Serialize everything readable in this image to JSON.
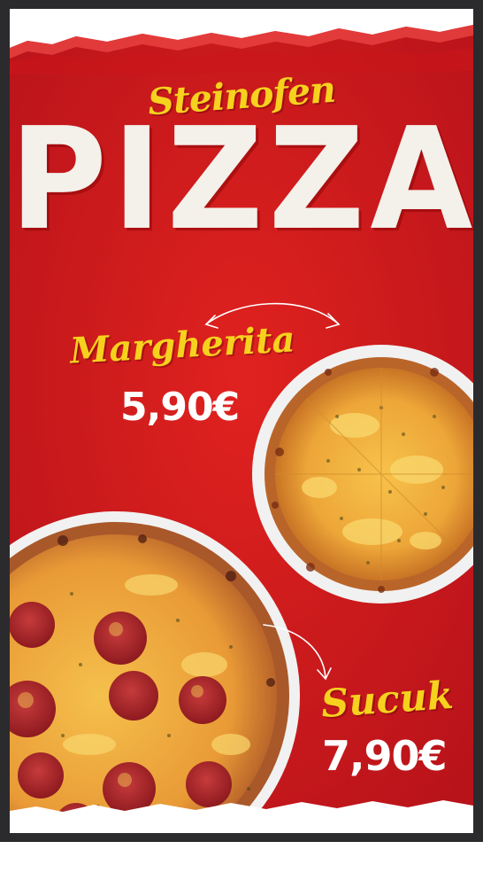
{
  "poster": {
    "subtitle": "Steinofen",
    "title": "PIZZA",
    "items": [
      {
        "name": "Margherita",
        "price": "5,90€"
      },
      {
        "name": "Sucuk",
        "price": "7,90€"
      }
    ]
  },
  "colors": {
    "background_red": "#d21a1c",
    "accent_yellow": "#f6d21e",
    "frame": "#2b2b2d",
    "title_white": "#f4f0ea"
  }
}
